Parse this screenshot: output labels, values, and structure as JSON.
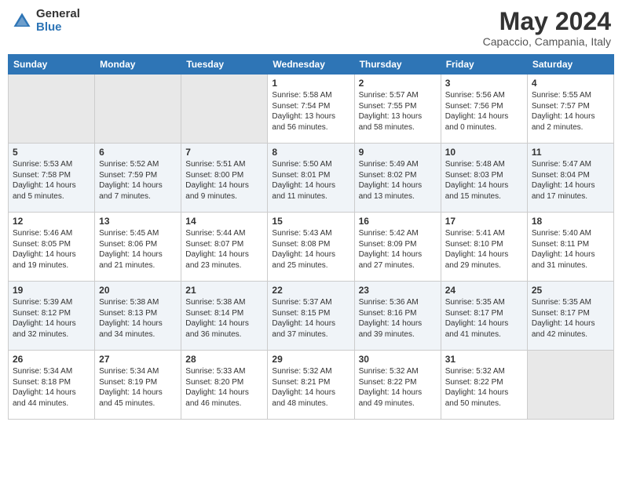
{
  "header": {
    "logo_general": "General",
    "logo_blue": "Blue",
    "month_title": "May 2024",
    "location": "Capaccio, Campania, Italy"
  },
  "weekdays": [
    "Sunday",
    "Monday",
    "Tuesday",
    "Wednesday",
    "Thursday",
    "Friday",
    "Saturday"
  ],
  "weeks": [
    [
      {
        "day": "",
        "sunrise": "",
        "sunset": "",
        "daylight": ""
      },
      {
        "day": "",
        "sunrise": "",
        "sunset": "",
        "daylight": ""
      },
      {
        "day": "",
        "sunrise": "",
        "sunset": "",
        "daylight": ""
      },
      {
        "day": "1",
        "sunrise": "Sunrise: 5:58 AM",
        "sunset": "Sunset: 7:54 PM",
        "daylight": "Daylight: 13 hours and 56 minutes."
      },
      {
        "day": "2",
        "sunrise": "Sunrise: 5:57 AM",
        "sunset": "Sunset: 7:55 PM",
        "daylight": "Daylight: 13 hours and 58 minutes."
      },
      {
        "day": "3",
        "sunrise": "Sunrise: 5:56 AM",
        "sunset": "Sunset: 7:56 PM",
        "daylight": "Daylight: 14 hours and 0 minutes."
      },
      {
        "day": "4",
        "sunrise": "Sunrise: 5:55 AM",
        "sunset": "Sunset: 7:57 PM",
        "daylight": "Daylight: 14 hours and 2 minutes."
      }
    ],
    [
      {
        "day": "5",
        "sunrise": "Sunrise: 5:53 AM",
        "sunset": "Sunset: 7:58 PM",
        "daylight": "Daylight: 14 hours and 5 minutes."
      },
      {
        "day": "6",
        "sunrise": "Sunrise: 5:52 AM",
        "sunset": "Sunset: 7:59 PM",
        "daylight": "Daylight: 14 hours and 7 minutes."
      },
      {
        "day": "7",
        "sunrise": "Sunrise: 5:51 AM",
        "sunset": "Sunset: 8:00 PM",
        "daylight": "Daylight: 14 hours and 9 minutes."
      },
      {
        "day": "8",
        "sunrise": "Sunrise: 5:50 AM",
        "sunset": "Sunset: 8:01 PM",
        "daylight": "Daylight: 14 hours and 11 minutes."
      },
      {
        "day": "9",
        "sunrise": "Sunrise: 5:49 AM",
        "sunset": "Sunset: 8:02 PM",
        "daylight": "Daylight: 14 hours and 13 minutes."
      },
      {
        "day": "10",
        "sunrise": "Sunrise: 5:48 AM",
        "sunset": "Sunset: 8:03 PM",
        "daylight": "Daylight: 14 hours and 15 minutes."
      },
      {
        "day": "11",
        "sunrise": "Sunrise: 5:47 AM",
        "sunset": "Sunset: 8:04 PM",
        "daylight": "Daylight: 14 hours and 17 minutes."
      }
    ],
    [
      {
        "day": "12",
        "sunrise": "Sunrise: 5:46 AM",
        "sunset": "Sunset: 8:05 PM",
        "daylight": "Daylight: 14 hours and 19 minutes."
      },
      {
        "day": "13",
        "sunrise": "Sunrise: 5:45 AM",
        "sunset": "Sunset: 8:06 PM",
        "daylight": "Daylight: 14 hours and 21 minutes."
      },
      {
        "day": "14",
        "sunrise": "Sunrise: 5:44 AM",
        "sunset": "Sunset: 8:07 PM",
        "daylight": "Daylight: 14 hours and 23 minutes."
      },
      {
        "day": "15",
        "sunrise": "Sunrise: 5:43 AM",
        "sunset": "Sunset: 8:08 PM",
        "daylight": "Daylight: 14 hours and 25 minutes."
      },
      {
        "day": "16",
        "sunrise": "Sunrise: 5:42 AM",
        "sunset": "Sunset: 8:09 PM",
        "daylight": "Daylight: 14 hours and 27 minutes."
      },
      {
        "day": "17",
        "sunrise": "Sunrise: 5:41 AM",
        "sunset": "Sunset: 8:10 PM",
        "daylight": "Daylight: 14 hours and 29 minutes."
      },
      {
        "day": "18",
        "sunrise": "Sunrise: 5:40 AM",
        "sunset": "Sunset: 8:11 PM",
        "daylight": "Daylight: 14 hours and 31 minutes."
      }
    ],
    [
      {
        "day": "19",
        "sunrise": "Sunrise: 5:39 AM",
        "sunset": "Sunset: 8:12 PM",
        "daylight": "Daylight: 14 hours and 32 minutes."
      },
      {
        "day": "20",
        "sunrise": "Sunrise: 5:38 AM",
        "sunset": "Sunset: 8:13 PM",
        "daylight": "Daylight: 14 hours and 34 minutes."
      },
      {
        "day": "21",
        "sunrise": "Sunrise: 5:38 AM",
        "sunset": "Sunset: 8:14 PM",
        "daylight": "Daylight: 14 hours and 36 minutes."
      },
      {
        "day": "22",
        "sunrise": "Sunrise: 5:37 AM",
        "sunset": "Sunset: 8:15 PM",
        "daylight": "Daylight: 14 hours and 37 minutes."
      },
      {
        "day": "23",
        "sunrise": "Sunrise: 5:36 AM",
        "sunset": "Sunset: 8:16 PM",
        "daylight": "Daylight: 14 hours and 39 minutes."
      },
      {
        "day": "24",
        "sunrise": "Sunrise: 5:35 AM",
        "sunset": "Sunset: 8:17 PM",
        "daylight": "Daylight: 14 hours and 41 minutes."
      },
      {
        "day": "25",
        "sunrise": "Sunrise: 5:35 AM",
        "sunset": "Sunset: 8:17 PM",
        "daylight": "Daylight: 14 hours and 42 minutes."
      }
    ],
    [
      {
        "day": "26",
        "sunrise": "Sunrise: 5:34 AM",
        "sunset": "Sunset: 8:18 PM",
        "daylight": "Daylight: 14 hours and 44 minutes."
      },
      {
        "day": "27",
        "sunrise": "Sunrise: 5:34 AM",
        "sunset": "Sunset: 8:19 PM",
        "daylight": "Daylight: 14 hours and 45 minutes."
      },
      {
        "day": "28",
        "sunrise": "Sunrise: 5:33 AM",
        "sunset": "Sunset: 8:20 PM",
        "daylight": "Daylight: 14 hours and 46 minutes."
      },
      {
        "day": "29",
        "sunrise": "Sunrise: 5:32 AM",
        "sunset": "Sunset: 8:21 PM",
        "daylight": "Daylight: 14 hours and 48 minutes."
      },
      {
        "day": "30",
        "sunrise": "Sunrise: 5:32 AM",
        "sunset": "Sunset: 8:22 PM",
        "daylight": "Daylight: 14 hours and 49 minutes."
      },
      {
        "day": "31",
        "sunrise": "Sunrise: 5:32 AM",
        "sunset": "Sunset: 8:22 PM",
        "daylight": "Daylight: 14 hours and 50 minutes."
      },
      {
        "day": "",
        "sunrise": "",
        "sunset": "",
        "daylight": ""
      }
    ]
  ]
}
